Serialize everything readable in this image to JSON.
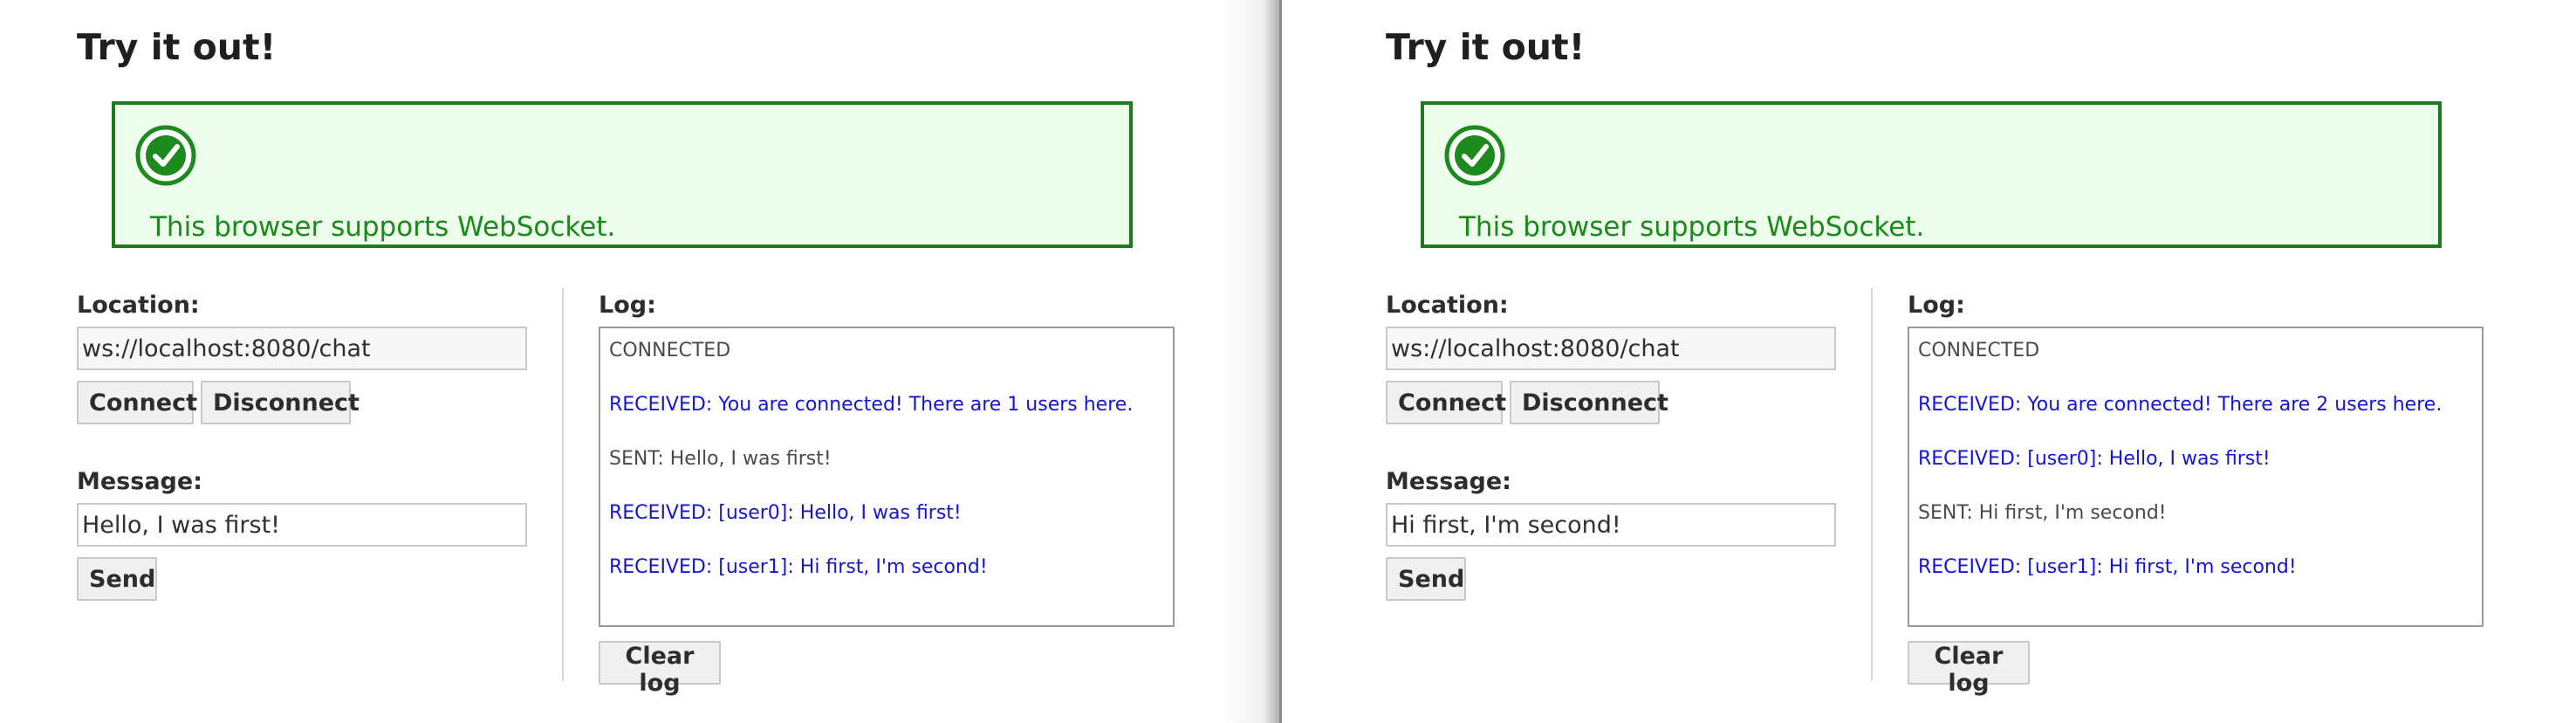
{
  "panels": [
    {
      "title": "Try it out!",
      "support_message": "This browser supports WebSocket.",
      "location": {
        "label": "Location:",
        "value": "ws://localhost:8080/chat"
      },
      "connect_label": "Connect",
      "disconnect_label": "Disconnect",
      "message": {
        "label": "Message:",
        "value": "Hello, I was first!"
      },
      "send_label": "Send",
      "log": {
        "label": "Log:",
        "entries": [
          {
            "type": "sent",
            "text": "CONNECTED"
          },
          {
            "type": "received",
            "text": "RECEIVED: You are connected! There are 1 users here."
          },
          {
            "type": "sent",
            "text": "SENT: Hello, I was first!"
          },
          {
            "type": "received",
            "text": "RECEIVED: [user0]: Hello, I was first!"
          },
          {
            "type": "received",
            "text": "RECEIVED: [user1]: Hi first, I'm second!"
          }
        ]
      },
      "clear_label": "Clear log"
    },
    {
      "title": "Try it out!",
      "support_message": "This browser supports WebSocket.",
      "location": {
        "label": "Location:",
        "value": "ws://localhost:8080/chat"
      },
      "connect_label": "Connect",
      "disconnect_label": "Disconnect",
      "message": {
        "label": "Message:",
        "value": "Hi first, I'm second!"
      },
      "send_label": "Send",
      "log": {
        "label": "Log:",
        "entries": [
          {
            "type": "sent",
            "text": "CONNECTED"
          },
          {
            "type": "received",
            "text": "RECEIVED: You are connected! There are 2 users here."
          },
          {
            "type": "received",
            "text": "RECEIVED: [user0]: Hello, I was first!"
          },
          {
            "type": "sent",
            "text": "SENT: Hi first, I'm second!"
          },
          {
            "type": "received",
            "text": "RECEIVED: [user1]: Hi first, I'm second!"
          }
        ]
      },
      "clear_label": "Clear log"
    }
  ],
  "colors": {
    "success_border": "#1d7a1d",
    "success_background": "#ecfdec",
    "success_text": "#1b8a1b",
    "received_text": "#1414d4",
    "sent_text": "#4a4a4a"
  },
  "icons": {
    "support_status": "check-circle-icon"
  }
}
